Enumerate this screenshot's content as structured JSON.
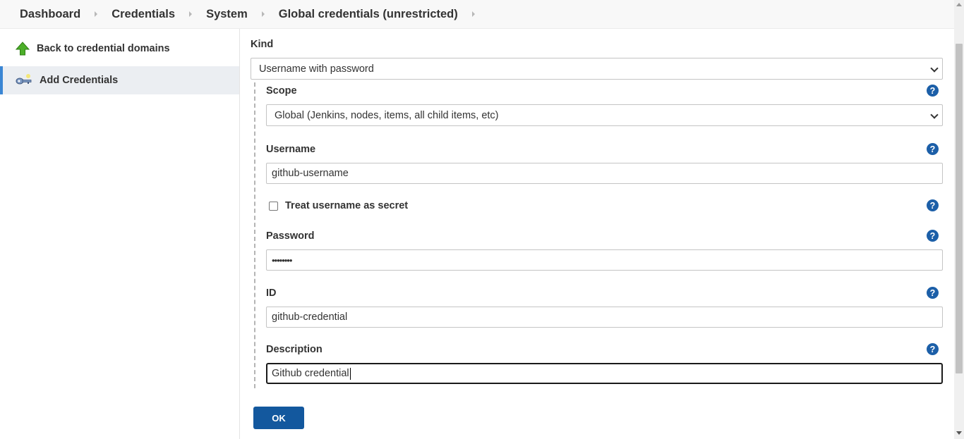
{
  "breadcrumb": {
    "items": [
      {
        "label": "Dashboard"
      },
      {
        "label": "Credentials"
      },
      {
        "label": "System"
      },
      {
        "label": "Global credentials (unrestricted)"
      }
    ]
  },
  "sidebar": {
    "items": [
      {
        "label": "Back to credential domains",
        "icon": "up-arrow-icon"
      },
      {
        "label": "Add Credentials",
        "icon": "key-icon",
        "active": true
      }
    ]
  },
  "form": {
    "kind": {
      "label": "Kind",
      "value": "Username with password"
    },
    "scope": {
      "label": "Scope",
      "value": "Global (Jenkins, nodes, items, all child items, etc)"
    },
    "username": {
      "label": "Username",
      "value": "github-username"
    },
    "treat_secret": {
      "label": "Treat username as secret",
      "checked": false
    },
    "password": {
      "label": "Password",
      "value": "••••••••"
    },
    "id": {
      "label": "ID",
      "value": "github-credential"
    },
    "description": {
      "label": "Description",
      "value": "Github credential"
    },
    "help_glyph": "?",
    "ok_label": "OK"
  },
  "colors": {
    "primary_button": "#13589e",
    "help_icon": "#1c5fa8",
    "active_indicator": "#3a86d4"
  }
}
